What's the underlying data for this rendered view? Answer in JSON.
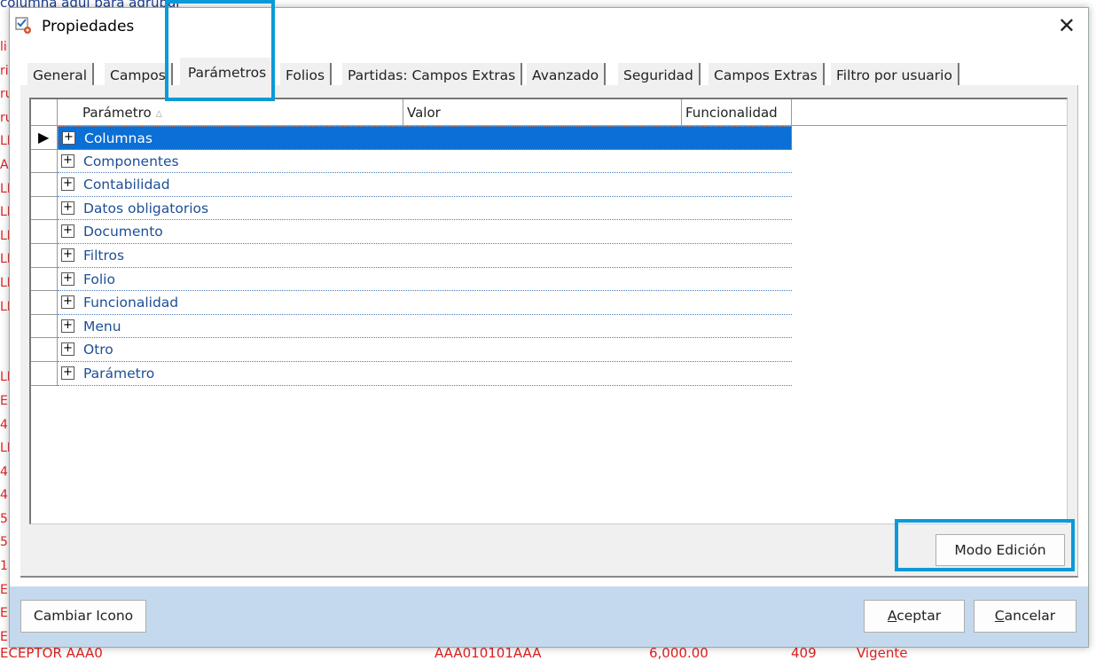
{
  "background": {
    "top_text": "columna aquí para agrupar",
    "left_letters": [
      "li",
      "ri",
      "ru",
      "ru",
      "LI",
      "A",
      "LI",
      "LI",
      "LI",
      "LI",
      "LI",
      "LI",
      "",
      "",
      "LI",
      "E",
      "4",
      "LI",
      "4",
      "4",
      "5",
      "5",
      "1",
      "E",
      "E",
      "E"
    ],
    "bottom_row": [
      "ECEPTOR AAA0",
      "AAA010101AAA",
      "6,000.00",
      "409",
      "Vigente"
    ]
  },
  "dialog": {
    "title": "Propiedades",
    "close_icon": "close-icon",
    "tabs": [
      "General",
      "Campos",
      "Parámetros",
      "Folios",
      "Partidas: Campos Extras",
      "Avanzado",
      "Seguridad",
      "Campos Extras",
      "Filtro por usuario"
    ],
    "active_tab": "Parámetros",
    "grid": {
      "columns": [
        "Parámetro",
        "Valor",
        "Funcionalidad"
      ],
      "sort_indicator": "▵",
      "rows": [
        "Columnas",
        "Componentes",
        "Contabilidad",
        "Datos obligatorios",
        "Documento",
        "Filtros",
        "Folio",
        "Funcionalidad",
        "Menu",
        "Otro",
        "Parámetro"
      ],
      "selected_row": 0
    },
    "edit_mode_button": "Modo Edición",
    "change_icon_button": "Cambiar Icono",
    "accept_button": {
      "accel": "A",
      "rest": "ceptar"
    },
    "cancel_button": {
      "accel": "C",
      "rest": "ancelar"
    }
  },
  "colors": {
    "highlight": "#0b9ad8",
    "selection": "#0a6fd6",
    "footer": "#c5d9ee"
  }
}
